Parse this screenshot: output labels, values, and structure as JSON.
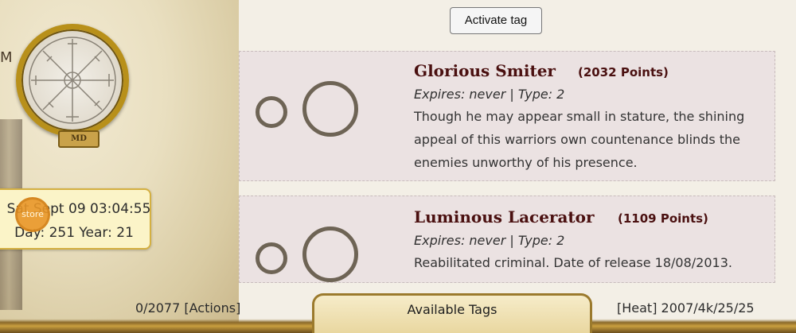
{
  "left_panel": {
    "edge_letter": "M",
    "amulet_plate": "MD",
    "clock": {
      "line1": "Sat Sept 09 03:04:55",
      "line2": "Day: 251 Year: 21"
    },
    "store_badge": "store"
  },
  "toolbar": {
    "activate_label": "Activate tag"
  },
  "tags": [
    {
      "name": "Glorious Smiter",
      "points": "(2032 Points)",
      "meta": "Expires: never | Type: 2",
      "description": "Though he may appear small in stature, the shining appeal of this warriors own countenance blinds the enemies unworthy of his presence."
    },
    {
      "name": "Luminous Lacerator",
      "points": "(1109 Points)",
      "meta": "Expires: never | Type: 2",
      "description": "Reabilitated criminal. Date of release 18/08/2013."
    }
  ],
  "footer": {
    "actions": "0/2077 [Actions]",
    "tab_label": "Available Tags",
    "heat": "[Heat] 2007/4k/25/25"
  },
  "colors": {
    "accent": "#4a1010",
    "card_bg": "#ebe2e2",
    "gold": "#b8901a",
    "ring": "#6e6455"
  }
}
